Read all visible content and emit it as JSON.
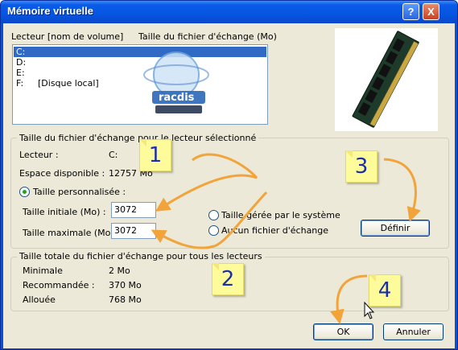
{
  "window": {
    "title": "Mémoire virtuelle",
    "help_label": "?",
    "close_label": "X"
  },
  "drives": {
    "header_drive": "Lecteur [nom de volume]",
    "header_size": "Taille du fichier d'échange (Mo)",
    "items": [
      {
        "letter": "C:",
        "volume": "",
        "selected": true
      },
      {
        "letter": "D:",
        "volume": ""
      },
      {
        "letter": "E:",
        "volume": ""
      },
      {
        "letter": "F:",
        "volume": "[Disque local]"
      }
    ]
  },
  "selected_drive": {
    "group_title": "Taille du fichier d'échange pour le lecteur sélectionné",
    "drive_label": "Lecteur :",
    "drive_value": "C:",
    "space_label": "Espace disponible :",
    "space_value": "12757 Mo",
    "custom_size_label": "Taille personnalisée :",
    "initial_label": "Taille initiale (Mo) :",
    "initial_value": "3072",
    "max_label": "Taille maximale (Mo) :",
    "max_value": "3072",
    "system_managed_label": "Taille gérée par le système",
    "no_paging_label": "Aucun fichier d'échange",
    "define_button": "Définir"
  },
  "totals": {
    "group_title": "Taille totale du fichier d'échange pour tous les lecteurs",
    "min_label": "Minimale",
    "min_value": "2 Mo",
    "recommended_label": "Recommandée :",
    "recommended_value": "370 Mo",
    "allocated_label": "Allouée",
    "allocated_value": "768 Mo"
  },
  "buttons": {
    "ok": "OK",
    "cancel": "Annuler"
  },
  "annotations": {
    "step1": "1",
    "step2": "2",
    "step3": "3",
    "step4": "4",
    "arrow_color": "#f2a33a",
    "note_color": "#fdfb9a",
    "number_color": "#1a2fb0"
  },
  "watermark": {
    "logo_text": "racdis",
    "icon": "globe-logo-icon"
  }
}
